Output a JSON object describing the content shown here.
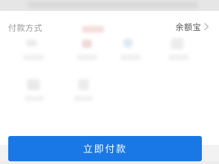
{
  "payment": {
    "label": "付款方式",
    "method": "余额宝",
    "chevron_icon": "chevron-right-icon"
  },
  "actions": {
    "pay_now_label": "立即付款"
  },
  "colors": {
    "primary": "#1a78e6",
    "label_text": "#9a9a9a",
    "value_text": "#555555",
    "card_bg": "#ffffff",
    "page_bg": "#f2f2f2"
  }
}
